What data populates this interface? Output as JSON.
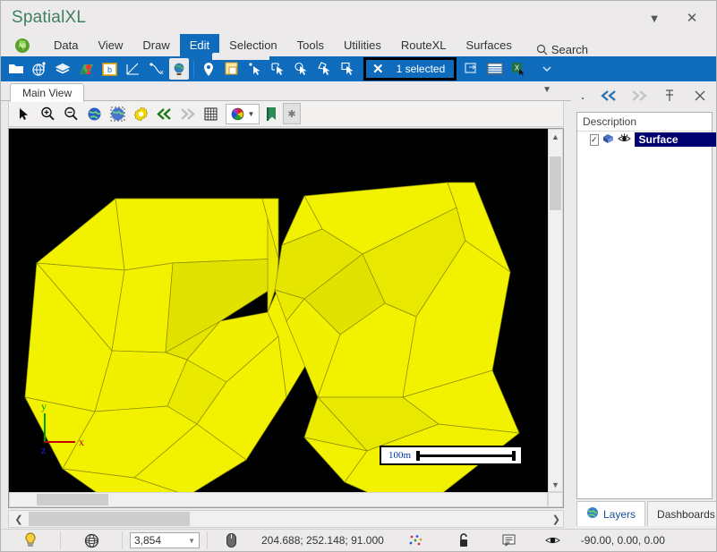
{
  "window": {
    "title": "SpatialXL",
    "dropdown_icon": "chevron-down-icon",
    "close_icon": "close-icon"
  },
  "menu": {
    "app_icon": "africa-globe-icon",
    "items": [
      {
        "label": "Data",
        "active": false
      },
      {
        "label": "View",
        "active": false
      },
      {
        "label": "Draw",
        "active": false
      },
      {
        "label": "Edit",
        "active": true
      },
      {
        "label": "Selection",
        "active": false
      },
      {
        "label": "Tools",
        "active": false
      },
      {
        "label": "Utilities",
        "active": false
      },
      {
        "label": "RouteXL",
        "active": false
      },
      {
        "label": "Surfaces",
        "active": false
      }
    ],
    "search_label": "Search",
    "search_icon": "search-icon"
  },
  "main_toolbar": {
    "icons": [
      "open-folder-icon",
      "globe-pin-icon",
      "layers-icon",
      "map-marker-icon",
      "boundary-icon",
      "measure-angle-icon",
      "snap-point-icon",
      "globe-stand-icon"
    ],
    "icons_group2": [
      "location-pin-icon",
      "window-copy-icon"
    ],
    "select_icons": [
      "select-arrow-icon",
      "select-rect-icon",
      "select-circle-icon",
      "select-lasso-icon",
      "select-poly-icon"
    ],
    "selection_clear_icon": "clear-selection-icon",
    "selected_count": "1 selected",
    "post_icons": [
      "duplicate-window-icon",
      "table-view-icon",
      "excel-export-icon"
    ],
    "overflow_icon": "chevron-down-icon"
  },
  "view": {
    "tab_label": "Main View",
    "tab_overflow_icon": "chevron-down-icon",
    "toolbar_icons": [
      "pointer-icon",
      "zoom-in-icon",
      "zoom-out-icon",
      "globe-icon",
      "globe-select-icon",
      "settings-gear-icon",
      "rewind-icon",
      "forward-icon",
      "grid-icon",
      "palette-icon",
      "bookmark-icon",
      "star-icon"
    ],
    "scale_label": "100m",
    "axis": {
      "x": "x",
      "y": "y",
      "z": "z"
    }
  },
  "right_panel": {
    "toolbar_icons": [
      "back-icon",
      "forward-icon",
      "pin-icon",
      "close-icon"
    ],
    "column_header": "Description",
    "rows": [
      {
        "label": "Surface",
        "checked": true,
        "checkbox_mark": "✓",
        "layer_icon": "layer-cube-icon",
        "visibility_icon": "eye-icon",
        "selected": true
      }
    ],
    "tabs": [
      {
        "label": "Layers",
        "icon": "globe-icon",
        "active": true
      },
      {
        "label": "Dashboards",
        "icon": "",
        "active": false
      }
    ]
  },
  "status_bar": {
    "bulb_icon": "lightbulb-icon",
    "wireframe_icon": "wireframe-globe-icon",
    "zoom_value": "3,854",
    "zoom_dropdown_icon": "chevron-down-icon",
    "mouse_icon": "mouse-icon",
    "coordinates": "204.688; 252.148; 91.000",
    "snap_icon": "snap-dots-icon",
    "lock_icon": "unlock-icon",
    "note_icon": "note-icon",
    "eye_icon": "eye-icon",
    "orientation": "-90.00, 0.00, 0.00"
  },
  "canvas": {
    "background_color": "#000000",
    "surface_fill": "#f0f000",
    "surface_fill_shade": "#d7d700",
    "edge_color": "#7a7a00"
  }
}
